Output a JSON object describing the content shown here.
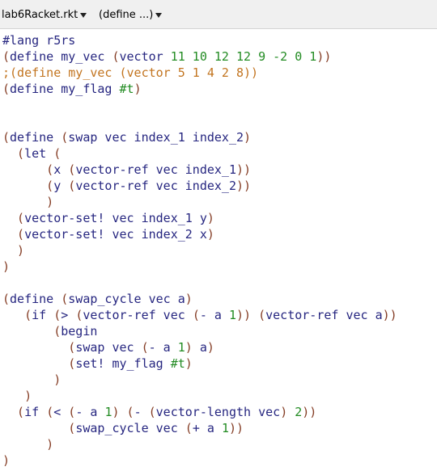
{
  "toolbar": {
    "file_menu_label": "lab6Racket.rkt",
    "define_menu_label": "(define ...)"
  },
  "colors": {
    "identifier": "#262680",
    "paren": "#843c24",
    "constant": "#228b22",
    "comment": "#c2741f"
  },
  "code": [
    [
      {
        "t": "#lang r5rs",
        "c": "kw"
      }
    ],
    [
      {
        "t": "(",
        "c": "par"
      },
      {
        "t": "define my_vec ",
        "c": "kw"
      },
      {
        "t": "(",
        "c": "par"
      },
      {
        "t": "vector ",
        "c": "kw"
      },
      {
        "t": "11 10 12 12 9 -2 0 1",
        "c": "num"
      },
      {
        "t": "))",
        "c": "par"
      }
    ],
    [
      {
        "t": ";(define my_vec (vector 5 1 4 2 8))",
        "c": "cm"
      }
    ],
    [
      {
        "t": "(",
        "c": "par"
      },
      {
        "t": "define my_flag ",
        "c": "kw"
      },
      {
        "t": "#t",
        "c": "bool"
      },
      {
        "t": ")",
        "c": "par"
      }
    ],
    [],
    [],
    [
      {
        "t": "(",
        "c": "par"
      },
      {
        "t": "define ",
        "c": "kw"
      },
      {
        "t": "(",
        "c": "par"
      },
      {
        "t": "swap vec index_1 index_2",
        "c": "kw"
      },
      {
        "t": ")",
        "c": "par"
      }
    ],
    [
      {
        "t": "  (",
        "c": "par"
      },
      {
        "t": "let ",
        "c": "kw"
      },
      {
        "t": "(",
        "c": "par"
      }
    ],
    [
      {
        "t": "      (",
        "c": "par"
      },
      {
        "t": "x ",
        "c": "kw"
      },
      {
        "t": "(",
        "c": "par"
      },
      {
        "t": "vector-ref vec index_1",
        "c": "kw"
      },
      {
        "t": "))",
        "c": "par"
      }
    ],
    [
      {
        "t": "      (",
        "c": "par"
      },
      {
        "t": "y ",
        "c": "kw"
      },
      {
        "t": "(",
        "c": "par"
      },
      {
        "t": "vector-ref vec index_2",
        "c": "kw"
      },
      {
        "t": "))",
        "c": "par"
      }
    ],
    [
      {
        "t": "      )",
        "c": "par"
      }
    ],
    [
      {
        "t": "  (",
        "c": "par"
      },
      {
        "t": "vector-set! vec index_1 y",
        "c": "kw"
      },
      {
        "t": ")",
        "c": "par"
      }
    ],
    [
      {
        "t": "  (",
        "c": "par"
      },
      {
        "t": "vector-set! vec index_2 x",
        "c": "kw"
      },
      {
        "t": ")",
        "c": "par"
      }
    ],
    [
      {
        "t": "  )",
        "c": "par"
      }
    ],
    [
      {
        "t": ")",
        "c": "par"
      }
    ],
    [],
    [
      {
        "t": "(",
        "c": "par"
      },
      {
        "t": "define ",
        "c": "kw"
      },
      {
        "t": "(",
        "c": "par"
      },
      {
        "t": "swap_cycle vec a",
        "c": "kw"
      },
      {
        "t": ")",
        "c": "par"
      }
    ],
    [
      {
        "t": "   (",
        "c": "par"
      },
      {
        "t": "if ",
        "c": "kw"
      },
      {
        "t": "(",
        "c": "par"
      },
      {
        "t": "> ",
        "c": "kw"
      },
      {
        "t": "(",
        "c": "par"
      },
      {
        "t": "vector-ref vec ",
        "c": "kw"
      },
      {
        "t": "(",
        "c": "par"
      },
      {
        "t": "- a ",
        "c": "kw"
      },
      {
        "t": "1",
        "c": "num"
      },
      {
        "t": ")) (",
        "c": "par"
      },
      {
        "t": "vector-ref vec a",
        "c": "kw"
      },
      {
        "t": "))",
        "c": "par"
      }
    ],
    [
      {
        "t": "       (",
        "c": "par"
      },
      {
        "t": "begin",
        "c": "kw"
      }
    ],
    [
      {
        "t": "         (",
        "c": "par"
      },
      {
        "t": "swap vec ",
        "c": "kw"
      },
      {
        "t": "(",
        "c": "par"
      },
      {
        "t": "- a ",
        "c": "kw"
      },
      {
        "t": "1",
        "c": "num"
      },
      {
        "t": ") ",
        "c": "par"
      },
      {
        "t": "a",
        "c": "kw"
      },
      {
        "t": ")",
        "c": "par"
      }
    ],
    [
      {
        "t": "         (",
        "c": "par"
      },
      {
        "t": "set! my_flag ",
        "c": "kw"
      },
      {
        "t": "#t",
        "c": "bool"
      },
      {
        "t": ")",
        "c": "par"
      }
    ],
    [
      {
        "t": "       )",
        "c": "par"
      }
    ],
    [
      {
        "t": "   )",
        "c": "par"
      }
    ],
    [
      {
        "t": "  (",
        "c": "par"
      },
      {
        "t": "if ",
        "c": "kw"
      },
      {
        "t": "(",
        "c": "par"
      },
      {
        "t": "< ",
        "c": "kw"
      },
      {
        "t": "(",
        "c": "par"
      },
      {
        "t": "- a ",
        "c": "kw"
      },
      {
        "t": "1",
        "c": "num"
      },
      {
        "t": ") (",
        "c": "par"
      },
      {
        "t": "- ",
        "c": "kw"
      },
      {
        "t": "(",
        "c": "par"
      },
      {
        "t": "vector-length vec",
        "c": "kw"
      },
      {
        "t": ") ",
        "c": "par"
      },
      {
        "t": "2",
        "c": "num"
      },
      {
        "t": "))",
        "c": "par"
      }
    ],
    [
      {
        "t": "         (",
        "c": "par"
      },
      {
        "t": "swap_cycle vec ",
        "c": "kw"
      },
      {
        "t": "(",
        "c": "par"
      },
      {
        "t": "+ a ",
        "c": "kw"
      },
      {
        "t": "1",
        "c": "num"
      },
      {
        "t": "))",
        "c": "par"
      }
    ],
    [
      {
        "t": "      )",
        "c": "par"
      }
    ],
    [
      {
        "t": ")",
        "c": "par"
      }
    ]
  ]
}
